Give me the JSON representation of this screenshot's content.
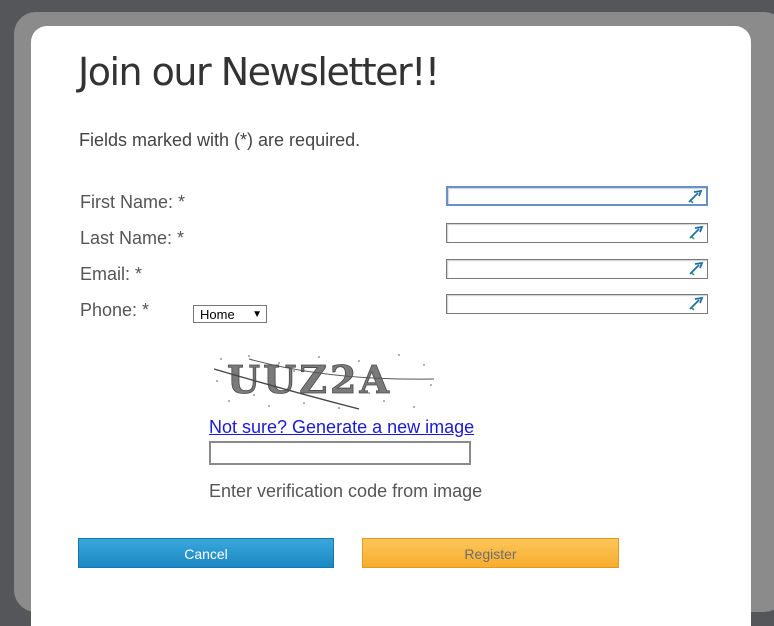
{
  "form": {
    "title": "Join our Newsletter!!",
    "required_note": "Fields marked with (*) are required.",
    "fields": {
      "first_name_label": "First Name:  *",
      "last_name_label": "Last Name:  *",
      "email_label": "Email: *",
      "phone_label": "Phone: *",
      "phone_type_selected": "Home"
    },
    "captcha": {
      "image_text": "UUZ2A",
      "new_image_link": "Not sure? Generate a new image",
      "help_text": "Enter verification code from image"
    },
    "buttons": {
      "cancel_label": "Cancel",
      "register_label": "Register"
    }
  },
  "colors": {
    "cancel_button": "#2a97d0",
    "register_button": "#fbb942",
    "link": "#1a1ad6",
    "focus_border": "#6b8fc7"
  },
  "icons": {
    "field_autofill": "autofill-key-icon",
    "dropdown": "chevron-down-icon"
  }
}
